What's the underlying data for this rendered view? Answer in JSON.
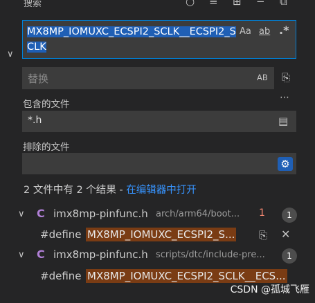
{
  "header": {
    "title": "搜索"
  },
  "search": {
    "value": "MX8MP_IOMUXC_ECSPI2_SCLK__ECSPI2_SCLK",
    "case_label": "Aa",
    "word_label": "ab",
    "regex_label": ".*"
  },
  "replace": {
    "placeholder": "替换",
    "preserve_case_label": "AB"
  },
  "include": {
    "label": "包含的文件",
    "value": "*.h"
  },
  "exclude": {
    "label": "排除的文件",
    "value": ""
  },
  "summary": {
    "text": "2 文件中有 2 个结果 - ",
    "link": "在编辑器中打开"
  },
  "results": [
    {
      "file": "imx8mp-pinfunc.h",
      "path": "arch/arm64/boot...",
      "problem_count": "1",
      "count": "1",
      "line_prefix": "#define ",
      "line_match": "MX8MP_IOMUXC_ECSPI2_S..."
    },
    {
      "file": "imx8mp-pinfunc.h",
      "path": "scripts/dtc/include-pre...",
      "count": "1",
      "line_prefix": "#define ",
      "line_match": "MX8MP_IOMUXC_ECSPI2_SCLK__ECS..."
    }
  ],
  "watermark": "CSDN @孤城飞雁",
  "colors": {
    "accent": "#007fd4",
    "selection": "#1f5fb5",
    "match_highlight": "#7a3c14",
    "file_icon": "#b180d7"
  }
}
